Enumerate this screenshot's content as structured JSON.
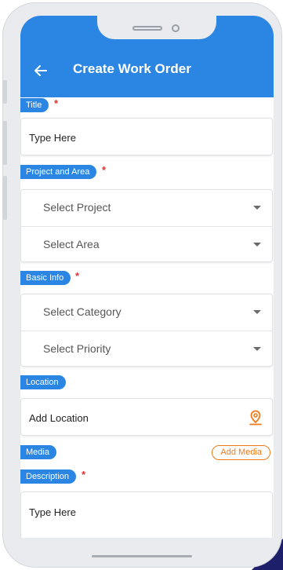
{
  "header": {
    "title": "Create Work Order"
  },
  "form": {
    "title_label": "Title",
    "title_placeholder": "Type Here",
    "project_area_label": "Project and Area",
    "select_project": "Select Project",
    "select_area": "Select Area",
    "basic_info_label": "Basic Info",
    "select_category": "Select Category",
    "select_priority": "Select Priority",
    "location_label": "Location",
    "location_placeholder": "Add Location",
    "media_label": "Media",
    "add_media": "Add Media",
    "description_label": "Description",
    "description_placeholder": "Type Here",
    "required_mark": "*"
  },
  "colors": {
    "accent": "#2b86e3",
    "required": "#e0312e",
    "action": "#f07a1a"
  },
  "icons": [
    "back-arrow-icon",
    "dropdown-caret-icon",
    "location-pin-icon"
  ]
}
